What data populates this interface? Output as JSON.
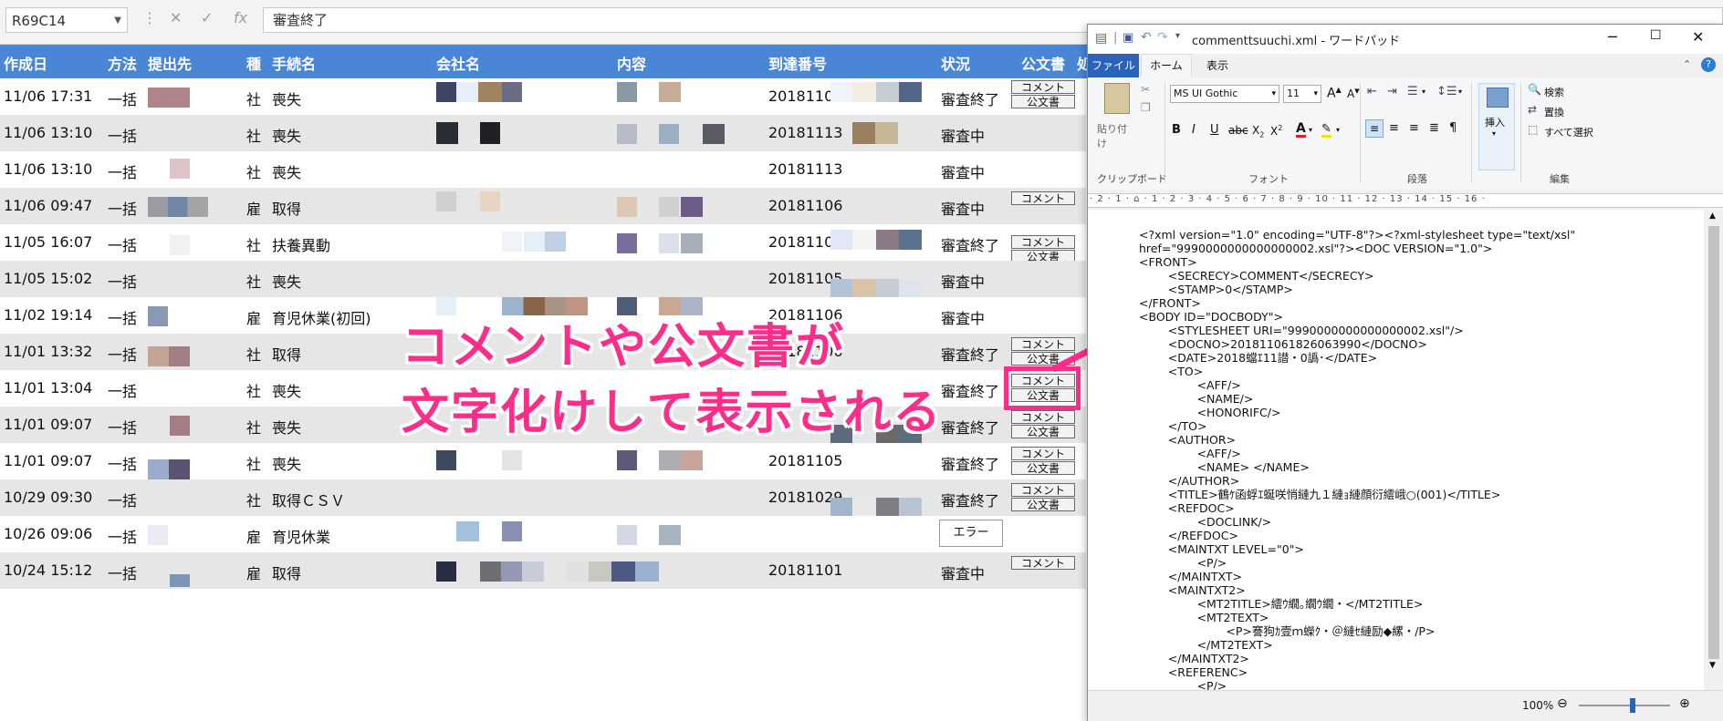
{
  "formula_bar": {
    "name_box": "R69C14",
    "content": "審査終了"
  },
  "sheet": {
    "headers": [
      "作成日",
      "方法",
      "提出先",
      "種",
      "手続名",
      "会社名",
      "内容",
      "到達番号",
      "状況",
      "公文書",
      "処"
    ],
    "rows": [
      {
        "date": "11/06 17:31",
        "method": "一括",
        "type": "社",
        "proc": "喪失",
        "arrival": "20181106",
        "status": "審査終了",
        "buttons": [
          "コメント",
          "公文書"
        ]
      },
      {
        "date": "11/06 13:10",
        "method": "一括",
        "type": "社",
        "proc": "喪失",
        "arrival": "20181113",
        "status": "審査中",
        "buttons": []
      },
      {
        "date": "11/06 13:10",
        "method": "一括",
        "type": "社",
        "proc": "喪失",
        "arrival": "20181113",
        "status": "審査中",
        "buttons": []
      },
      {
        "date": "11/06 09:47",
        "method": "一括",
        "type": "雇",
        "proc": "取得",
        "arrival": "20181106",
        "status": "審査中",
        "buttons": [
          "コメント"
        ]
      },
      {
        "date": "11/05 16:07",
        "method": "一括",
        "type": "社",
        "proc": "扶養異動",
        "arrival": "20181105",
        "status": "審査終了",
        "buttons": [
          "コメント",
          "公文書"
        ]
      },
      {
        "date": "11/05 15:02",
        "method": "一括",
        "type": "社",
        "proc": "喪失",
        "arrival": "20181105",
        "status": "審査中",
        "buttons": []
      },
      {
        "date": "11/02 19:14",
        "method": "一括",
        "type": "雇",
        "proc": "育児休業(初回)",
        "arrival": "20181106",
        "status": "審査中",
        "buttons": []
      },
      {
        "date": "11/01 13:32",
        "method": "一括",
        "type": "社",
        "proc": "取得",
        "arrival": "20181106",
        "status": "審査終了",
        "buttons": [
          "コメント",
          "公文書"
        ]
      },
      {
        "date": "11/01 13:04",
        "method": "一括",
        "type": "社",
        "proc": "喪失",
        "arrival": "",
        "status": "審査終了",
        "buttons": [
          "コメント",
          "公文書"
        ]
      },
      {
        "date": "11/01 09:07",
        "method": "一括",
        "type": "社",
        "proc": "喪失",
        "arrival": "",
        "status": "審査終了",
        "buttons": [
          "コメント",
          "公文書"
        ]
      },
      {
        "date": "11/01 09:07",
        "method": "一括",
        "type": "社",
        "proc": "喪失",
        "arrival": "20181105",
        "status": "審査終了",
        "buttons": [
          "コメント",
          "公文書"
        ]
      },
      {
        "date": "10/29 09:30",
        "method": "一括",
        "type": "社",
        "proc": "取得ＣＳＶ",
        "arrival": "20181029",
        "status": "審査終了",
        "buttons": [
          "コメント",
          "公文書"
        ]
      },
      {
        "date": "10/26 09:06",
        "method": "一括",
        "type": "雇",
        "proc": "育児休業",
        "arrival": "",
        "status": "エラー",
        "buttons": []
      },
      {
        "date": "10/24 15:12",
        "method": "一括",
        "type": "雇",
        "proc": "取得",
        "arrival": "20181101",
        "status": "審査中",
        "buttons": [
          "コメント"
        ]
      }
    ]
  },
  "annotation": {
    "line1": "コメントや公文書が",
    "line2": "文字化けして表示される",
    "color": "#ff2d8a"
  },
  "wordpad": {
    "title": "commenttsuuchi.xml - ワードパッド",
    "tabs": [
      "ファイル",
      "ホーム",
      "表示"
    ],
    "clipboard": {
      "paste": "貼り付け",
      "label": "クリップボード"
    },
    "font": {
      "name": "MS UI Gothic",
      "size": "11",
      "label": "フォント"
    },
    "paragraph_label": "段落",
    "insert_label": "挿入",
    "edit": {
      "find": "検索",
      "replace": "置換",
      "select_all": "すべて選択",
      "label": "編集"
    },
    "ruler": "· 2 · 1 · ⌂ · 1 · 2 · 3 · 4 · 5 · 6 · 7 · 8 · 9 · 10 · 11 · 12 · 13 · 14 · 15 · 16 ·",
    "zoom": "100%",
    "content": "<?xml version=\"1.0\" encoding=\"UTF-8\"?><?xml-stylesheet type=\"text/xsl\"\nhref=\"9990000000000000002.xsl\"?><DOC VERSION=\"1.0\">\n<FRONT>\n        <SECRECY>COMMENT</SECRECY>\n        <STAMP>0</STAMP>\n</FRONT>\n<BODY ID=\"DOCBODY\">\n        <STYLESHEET URI=\"9990000000000000002.xsl\"/>\n        <DOCNO>201811061826063990</DOCNO>\n        <DATE>2018蟷ｴ11譛・0譌･</DATE>\n        <TO>\n                <AFF/>\n                <NAME/>\n                <HONORIFC/>\n        </TO>\n        <AUTHOR>\n                <AFF/>\n                <NAME> </NAME>\n        </AUTHOR>\n        <TITLE>鶴ｹ函蜉ｴ蜒咲悄縺九１縺ｮ縺顔衍繧峨○(001)</TITLE>\n        <REFDOC>\n                <DOCLINK/>\n        </REFDOC>\n        <MAINTXT LEVEL=\"0\">\n                <P/>\n        </MAINTXT>\n        <MAINTXT2>\n                <MT2TITLE>繧ｳ繝｡繝ｳ繝・</MT2TITLE>\n                <MT2TEXT>\n                        <P>謇狗ｶ壹ｍ蠑ｸ・＠縺ｾ縺励◆縲・/P>\n                </MT2TEXT>\n        </MAINTXT2>\n        <REFERENC>\n                <P/>"
  }
}
